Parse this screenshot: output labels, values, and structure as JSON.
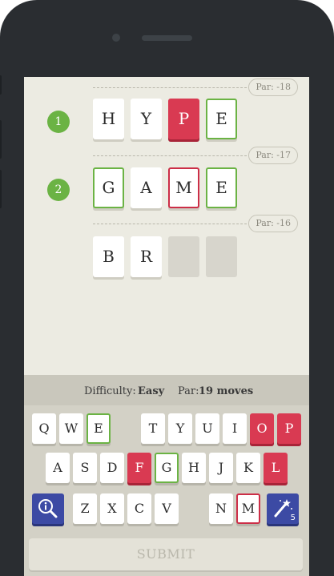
{
  "board": {
    "rows": [
      {
        "number": "1",
        "par": "Par: -18",
        "letters": [
          "H",
          "Y",
          "P",
          "E"
        ]
      },
      {
        "number": "2",
        "par": "Par: -17",
        "letters": [
          "G",
          "A",
          "M",
          "E"
        ]
      },
      {
        "number": "",
        "par": "Par: -16",
        "letters": [
          "B",
          "R",
          "",
          ""
        ]
      }
    ]
  },
  "status": {
    "difficulty_label": "Difficulty:",
    "difficulty_value": "Easy",
    "par_label": "Par:",
    "par_value": "19 moves"
  },
  "keyboard": {
    "row1": [
      "Q",
      "W",
      "E",
      "T",
      "Y",
      "U",
      "I",
      "O",
      "P"
    ],
    "row2": [
      "A",
      "S",
      "D",
      "F",
      "G",
      "H",
      "J",
      "K",
      "L"
    ],
    "row3": [
      "Z",
      "X",
      "C",
      "V",
      "N",
      "M"
    ],
    "hint_count": "5",
    "icons": {
      "left": "magnifier-info-icon",
      "right": "magic-wand-icon"
    },
    "colors": {
      "red": "#d93a52",
      "green": "#6bb344",
      "blue": "#3c4aa4"
    }
  },
  "submit_label": "SUBMIT"
}
